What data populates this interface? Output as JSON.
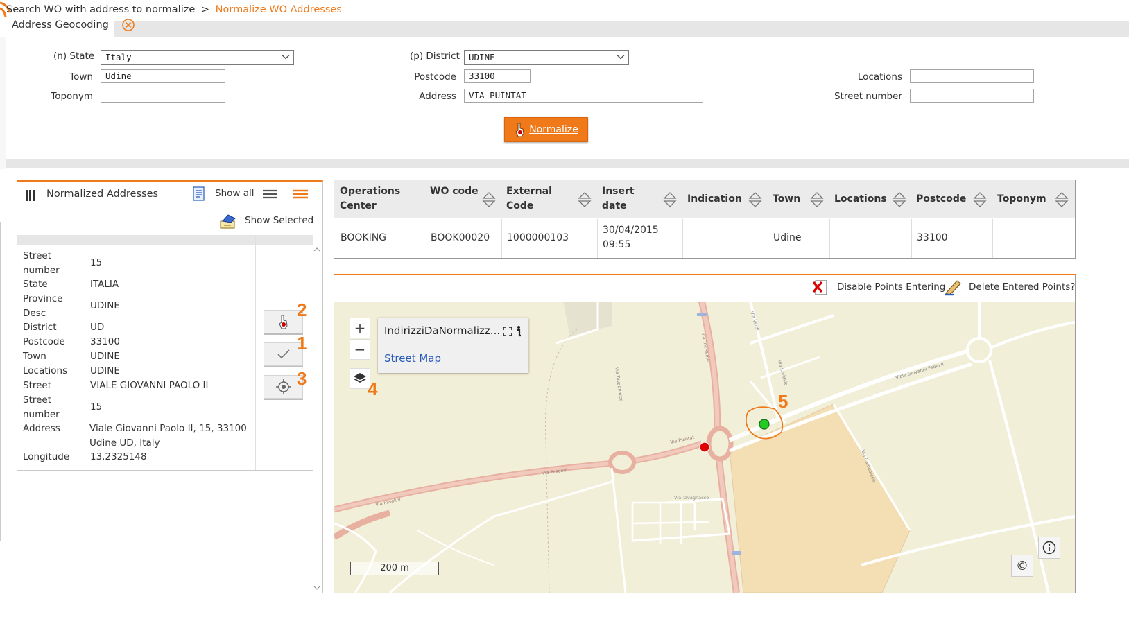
{
  "breadcrumb": {
    "parent": "Search WO with address to normalize",
    "separator": ">",
    "current": "Normalize WO Addresses"
  },
  "geocoding": {
    "tab_label": "Address Geocoding",
    "state": {
      "prefix": "(n)",
      "label": "State",
      "value": "Italy"
    },
    "district": {
      "prefix": "(p)",
      "label": "District",
      "value": "UDINE"
    },
    "town": {
      "label": "Town",
      "value": "Udine"
    },
    "postcode": {
      "label": "Postcode",
      "value": "33100"
    },
    "locations": {
      "label": "Locations",
      "value": ""
    },
    "toponym": {
      "label": "Toponym",
      "value": ""
    },
    "address": {
      "label": "Address",
      "value": "VIA PUINTAT"
    },
    "street_number": {
      "label": "Street number",
      "value": ""
    },
    "normalize_label": "Normalize"
  },
  "normalized_panel": {
    "title": "Normalized Addresses",
    "show_all_label": "Show all",
    "show_selected_label": "Show Selected",
    "details": [
      {
        "key": "Street number",
        "value": "15"
      },
      {
        "key": "State",
        "value": "ITALIA"
      },
      {
        "key": "Province Desc",
        "value": "UDINE"
      },
      {
        "key": "District",
        "value": "UD"
      },
      {
        "key": "Postcode",
        "value": "33100"
      },
      {
        "key": "Town",
        "value": "UDINE"
      },
      {
        "key": "Locations",
        "value": "UDINE"
      },
      {
        "key": "Street",
        "value": "VIALE GIOVANNI PAOLO II"
      },
      {
        "key": "Street number",
        "value": "15"
      },
      {
        "key": "Address",
        "value": "Viale Giovanni Paolo II, 15, 33100 Udine UD, Italy"
      },
      {
        "key": "Longitude",
        "value": "13.2325148"
      }
    ],
    "badges": [
      "2",
      "1",
      "3"
    ]
  },
  "table": {
    "headers": [
      "Operations Center",
      "WO code",
      "External Code",
      "Insert date",
      "Indication",
      "Town",
      "Locations",
      "Postcode",
      "Toponym"
    ],
    "rows": [
      [
        "BOOKING",
        "BOOK00020",
        "1000000103",
        "30/04/2015 09:55",
        "",
        "Udine",
        "",
        "33100",
        ""
      ]
    ]
  },
  "map": {
    "disable_points_label": "Disable Points Entering",
    "delete_points_label": "Delete Entered Points?",
    "zoom_in": "+",
    "zoom_out": "−",
    "layer_name": "IndirizziDaNormalizz...",
    "basemap_label": "Street Map",
    "scale_label": "200 m",
    "badge_layers": "4",
    "badge_point": "5",
    "info_symbol": "i",
    "copyright_symbol": "©",
    "street_labels": [
      "Via Puintat",
      "Viale Giovanni Paolo II",
      "Via Tricesimo",
      "Via Cividale",
      "Via Tavagnacco",
      "Via Tavagnacco",
      "Via Pasolini",
      "Via Campolesio",
      "Via Verdi",
      "Via Pasolini"
    ],
    "colors": {
      "red_point": "#e00000",
      "green_point": "#22cc22",
      "accent": "#f07a1a"
    }
  }
}
